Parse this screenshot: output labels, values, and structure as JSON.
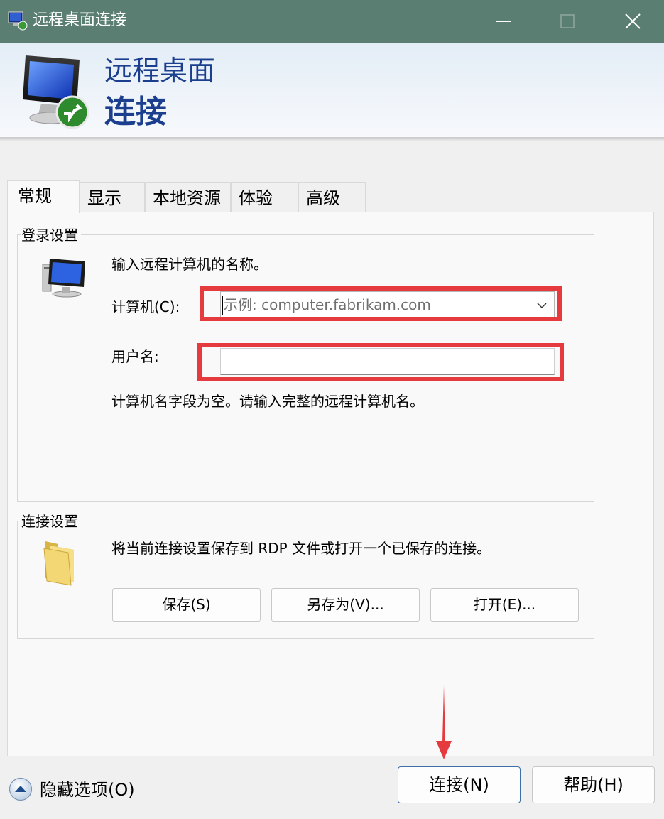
{
  "window": {
    "title": "远程桌面连接",
    "minimize_icon": "minimize-icon",
    "maximize_icon": "maximize-icon",
    "close_icon": "close-icon"
  },
  "banner": {
    "line1": "远程桌面",
    "line2": "连接",
    "icon": "remote-desktop-icon"
  },
  "tabs": [
    {
      "label": "常规",
      "active": true
    },
    {
      "label": "显示",
      "active": false
    },
    {
      "label": "本地资源",
      "active": false
    },
    {
      "label": "体验",
      "active": false
    },
    {
      "label": "高级",
      "active": false
    }
  ],
  "login_settings": {
    "group_title": "登录设置",
    "instruction": "输入远程计算机的名称。",
    "computer_label": "计算机(C):",
    "computer_placeholder": "示例: computer.fabrikam.com",
    "computer_value": "",
    "username_label": "用户名:",
    "username_value": "",
    "warning": "计算机名字段为空。请输入完整的远程计算机名。"
  },
  "connection_settings": {
    "group_title": "连接设置",
    "description": "将当前连接设置保存到 RDP 文件或打开一个已保存的连接。",
    "save_label": "保存(S)",
    "save_as_label": "另存为(V)...",
    "open_label": "打开(E)..."
  },
  "footer": {
    "hide_options_label": "隐藏选项(O)",
    "connect_label": "连接(N)",
    "help_label": "帮助(H)"
  },
  "colors": {
    "titlebar": "#5a7f72",
    "banner_text": "#1b3f8e",
    "highlight": "#e53a3e"
  }
}
